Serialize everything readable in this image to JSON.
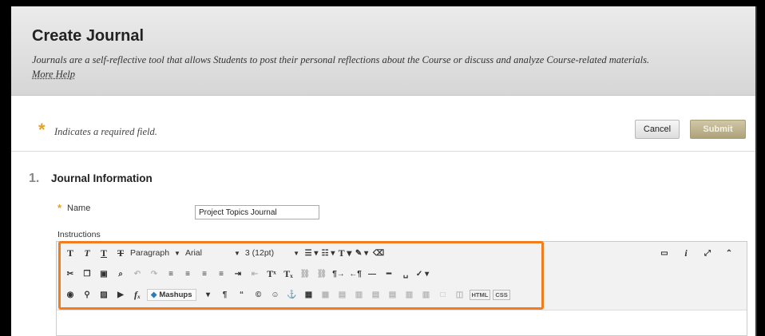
{
  "header": {
    "title": "Create Journal",
    "description": "Journals are a self-reflective tool that allows Students to post their personal reflections about the Course or discuss and analyze Course-related materials.",
    "more_help": "More Help"
  },
  "required_bar": {
    "star": "*",
    "text": "Indicates a required field.",
    "cancel_label": "Cancel",
    "submit_label": "Submit"
  },
  "section": {
    "number": "1.",
    "title": "Journal Information"
  },
  "name_field": {
    "star": "*",
    "label": "Name",
    "value": "Project Topics Journal"
  },
  "instructions_label": "Instructions",
  "toolbar": {
    "format_dropdown": "Paragraph",
    "font_dropdown": "Arial",
    "size_dropdown": "3 (12pt)",
    "mashups_label": "Mashups",
    "html_tag": "HTML",
    "css_tag": "CSS"
  },
  "colors": {
    "highlight": "#f07d1e",
    "required_star": "#e8a020",
    "submit_bg": "#aea27a"
  }
}
